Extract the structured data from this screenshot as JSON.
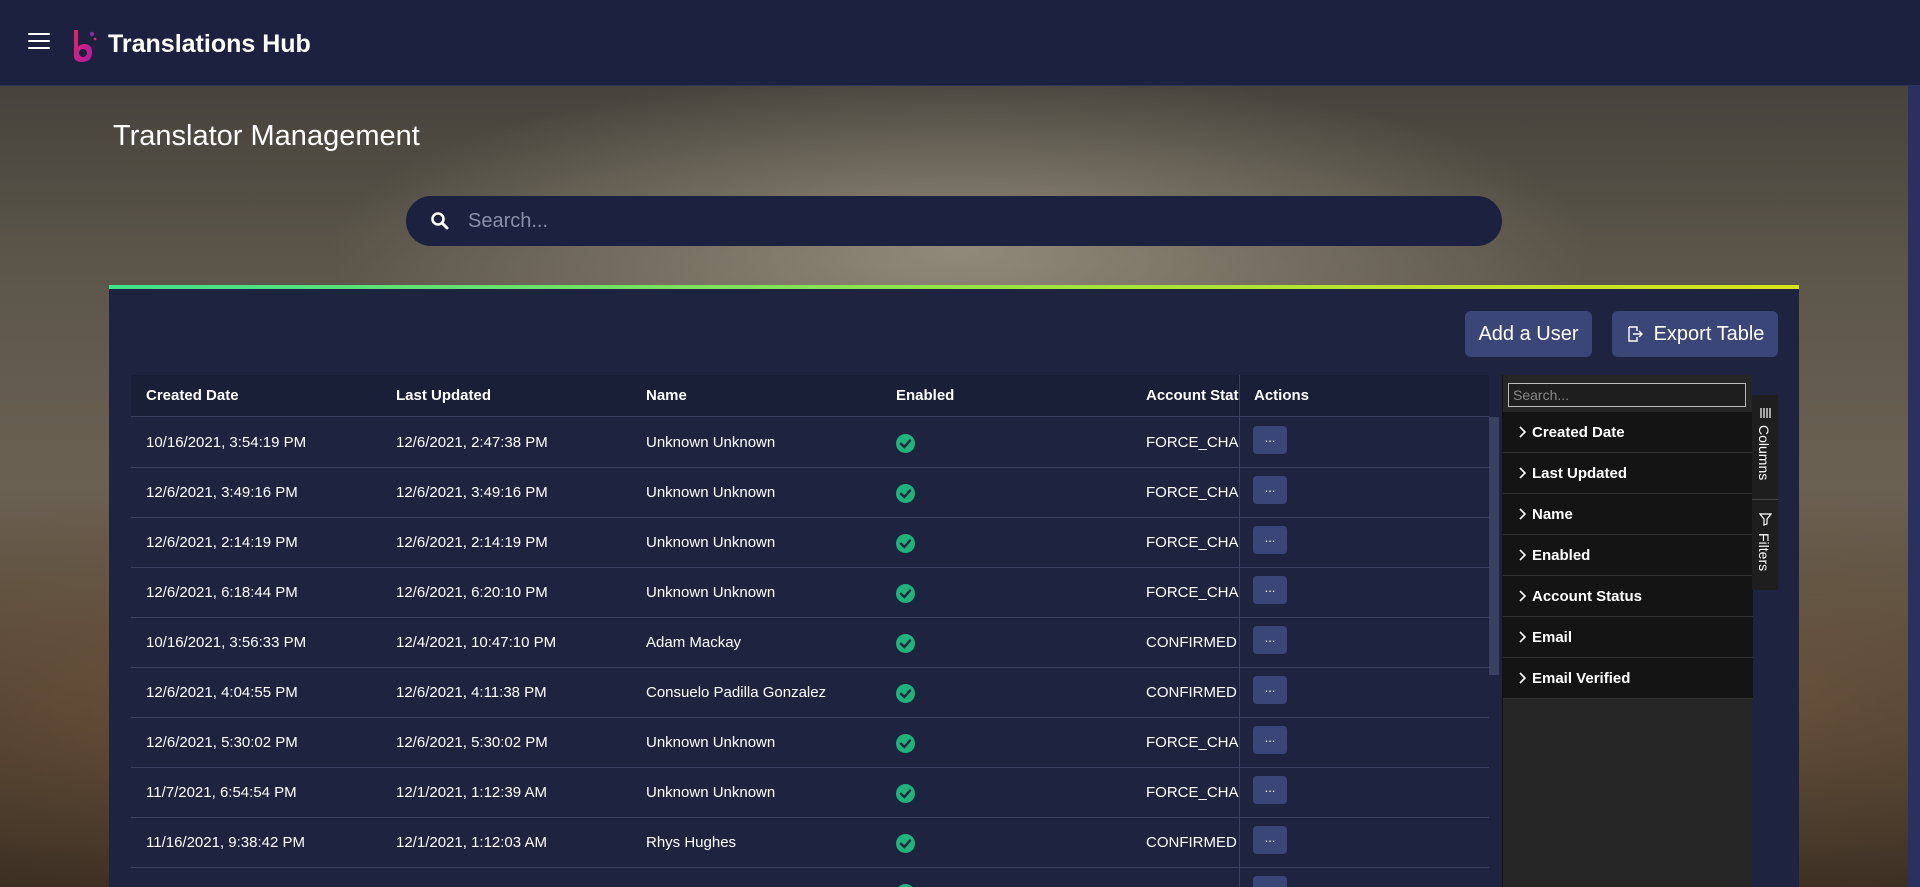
{
  "header": {
    "app_title": "Translations Hub"
  },
  "page": {
    "title": "Translator Management"
  },
  "search": {
    "placeholder": "Search..."
  },
  "toolbar": {
    "add_label": "Add a User",
    "export_label": "Export Table"
  },
  "grid": {
    "columns": [
      "Created Date",
      "Last Updated",
      "Name",
      "Enabled",
      "Account Status",
      "Actions"
    ],
    "column_header_visible": [
      "Created Date",
      "Last Updated",
      "Name",
      "Enabled",
      "Account Statu",
      "Actions"
    ],
    "rows": [
      {
        "created": "10/16/2021, 3:54:19 PM",
        "updated": "12/6/2021, 2:47:38 PM",
        "name": "Unknown Unknown",
        "enabled": true,
        "status": "FORCE_CHANG",
        "action": "..."
      },
      {
        "created": "12/6/2021, 3:49:16 PM",
        "updated": "12/6/2021, 3:49:16 PM",
        "name": "Unknown Unknown",
        "enabled": true,
        "status": "FORCE_CHANG",
        "action": "..."
      },
      {
        "created": "12/6/2021, 2:14:19 PM",
        "updated": "12/6/2021, 2:14:19 PM",
        "name": "Unknown Unknown",
        "enabled": true,
        "status": "FORCE_CHANG",
        "action": "..."
      },
      {
        "created": "12/6/2021, 6:18:44 PM",
        "updated": "12/6/2021, 6:20:10 PM",
        "name": "Unknown Unknown",
        "enabled": true,
        "status": "FORCE_CHANG",
        "action": "..."
      },
      {
        "created": "10/16/2021, 3:56:33 PM",
        "updated": "12/4/2021, 10:47:10 PM",
        "name": "Adam Mackay",
        "enabled": true,
        "status": "CONFIRMED",
        "action": "..."
      },
      {
        "created": "12/6/2021, 4:04:55 PM",
        "updated": "12/6/2021, 4:11:38 PM",
        "name": "Consuelo Padilla Gonzalez",
        "enabled": true,
        "status": "CONFIRMED",
        "action": "..."
      },
      {
        "created": "12/6/2021, 5:30:02 PM",
        "updated": "12/6/2021, 5:30:02 PM",
        "name": "Unknown Unknown",
        "enabled": true,
        "status": "FORCE_CHANG",
        "action": "..."
      },
      {
        "created": "11/7/2021, 6:54:54 PM",
        "updated": "12/1/2021, 1:12:39 AM",
        "name": "Unknown Unknown",
        "enabled": true,
        "status": "FORCE_CHANG",
        "action": "..."
      },
      {
        "created": "11/16/2021, 9:38:42 PM",
        "updated": "12/1/2021, 1:12:03 AM",
        "name": "Rhys Hughes",
        "enabled": true,
        "status": "CONFIRMED",
        "action": "..."
      },
      {
        "created": "",
        "updated": "",
        "name": "",
        "enabled": true,
        "status": "",
        "action": "..."
      }
    ]
  },
  "tool_panel": {
    "search_placeholder": "Search...",
    "columns": [
      "Created Date",
      "Last Updated",
      "Name",
      "Enabled",
      "Account Status",
      "Email",
      "Email Verified"
    ],
    "tabs": {
      "columns": "Columns",
      "filters": "Filters"
    }
  },
  "colors": {
    "topbar": "#1c2140",
    "panel": "#1e2440",
    "button": "#3a4677",
    "enabled_check": "#1fb27a",
    "accent_start": "#3fe08e",
    "accent_end": "#d6e31a"
  }
}
